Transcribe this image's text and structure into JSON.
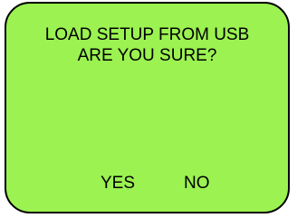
{
  "dialog": {
    "line1": "LOAD SETUP FROM USB",
    "line2": "ARE YOU SURE?",
    "yes_label": "YES",
    "no_label": "NO"
  },
  "colors": {
    "screen_background": "#9bf251",
    "text": "#000000",
    "border": "#000000"
  }
}
